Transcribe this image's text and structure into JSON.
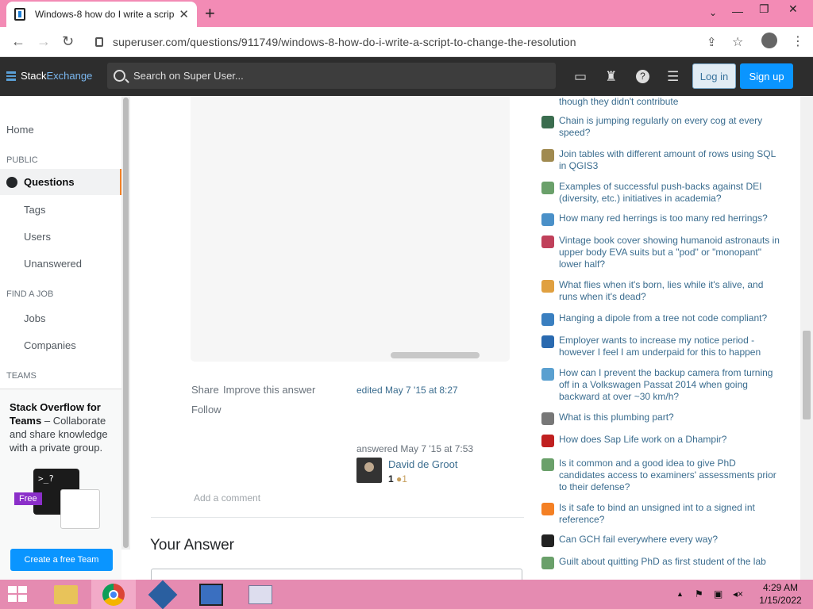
{
  "browser": {
    "tab_title": "Windows-8 how do I write a scrip",
    "url": "superuser.com/questions/911749/windows-8-how-do-i-write-a-script-to-change-the-resolution",
    "new_tab": "+",
    "close_tab": "✕",
    "win_min": "—",
    "win_max": "❐",
    "win_close": "✕"
  },
  "header": {
    "logo_part1": "Stack",
    "logo_part2": "Exchange",
    "search_placeholder": "Search on Super User...",
    "login_label": "Log in",
    "signup_label": "Sign up"
  },
  "sidebar": {
    "home": "Home",
    "public_heading": "PUBLIC",
    "questions": "Questions",
    "tags": "Tags",
    "users": "Users",
    "unanswered": "Unanswered",
    "job_heading": "FIND A JOB",
    "jobs": "Jobs",
    "companies": "Companies",
    "teams_heading": "TEAMS",
    "teams_title": "Stack Overflow for Teams",
    "teams_text": " – Collaborate and share knowledge with a private group.",
    "teams_button": "Create a free Team",
    "free_badge": "Free",
    "terminal_text": ">_?"
  },
  "post": {
    "share": "Share",
    "improve": "Improve this answer",
    "follow": "Follow",
    "edited": "edited May 7 '15 at 8:27",
    "answered": "answered May 7 '15 at 7:53",
    "user_name": "David de Groot",
    "user_rep": "1",
    "user_badges": "●1",
    "add_comment": "Add a comment",
    "your_answer": "Your Answer"
  },
  "hot_questions": [
    {
      "text": "though they didn't contribute",
      "icon_color": "#8b6b8b"
    },
    {
      "text": "Chain is jumping regularly on every cog at every speed?",
      "icon_color": "#3b6d4f"
    },
    {
      "text": "Join tables with different amount of rows using SQL in QGIS3",
      "icon_color": "#a08a50"
    },
    {
      "text": "Examples of successful push-backs against DEI (diversity, etc.) initiatives in academia?",
      "icon_color": "#6aa06a"
    },
    {
      "text": "How many red herrings is too many red herrings?",
      "icon_color": "#4a90c8"
    },
    {
      "text": "Vintage book cover showing humanoid astronauts in upper body EVA suits but a \"pod\" or \"monopant\" lower half?",
      "icon_color": "#c0405a"
    },
    {
      "text": "What flies when it's born, lies while it's alive, and runs when it's dead?",
      "icon_color": "#e0a040"
    },
    {
      "text": "Hanging a dipole from a tree not code compliant?",
      "icon_color": "#3a7fc0"
    },
    {
      "text": "Employer wants to increase my notice period - however I feel I am underpaid for this to happen",
      "icon_color": "#2a6ab0"
    },
    {
      "text": "How can I prevent the backup camera from turning off in a Volkswagen Passat 2014 when going backward at over ~30 km/h?",
      "icon_color": "#5aa0d0"
    },
    {
      "text": "What is this plumbing part?",
      "icon_color": "#777777"
    },
    {
      "text": "How does Sap Life work on a Dhampir?",
      "icon_color": "#c02020"
    },
    {
      "text": "Is it common and a good idea to give PhD candidates access to examiners' assessments prior to their defense?",
      "icon_color": "#6aa06a"
    },
    {
      "text": "Is it safe to bind an unsigned int to a signed int reference?",
      "icon_color": "#f48024"
    },
    {
      "text": "Can GCH fail everywhere every way?",
      "icon_color": "#222222"
    },
    {
      "text": "Guilt about quitting PhD as first student of the lab",
      "icon_color": "#6aa06a"
    }
  ],
  "taskbar": {
    "time": "4:29 AM",
    "date": "1/15/2022",
    "tray_arrow": "▲"
  }
}
